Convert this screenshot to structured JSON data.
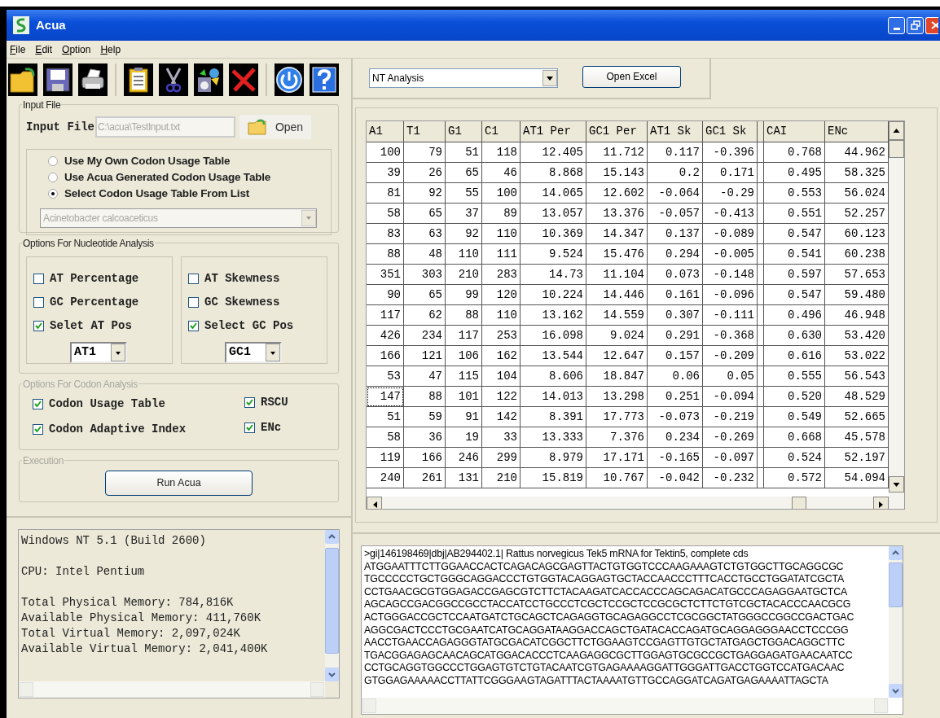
{
  "window": {
    "title": "Acua"
  },
  "menu": [
    "File",
    "Edit",
    "Option",
    "Help"
  ],
  "input_group": {
    "title": "Input File",
    "title_disabled": false,
    "label": "Input File",
    "value": "C:\\acua\\TestInput.txt",
    "disabled": true,
    "open_button": "Open",
    "options": [
      {
        "label": "Use My Own Codon Usage Table",
        "selected": false
      },
      {
        "label": "Use Acua Generated Codon Usage Table",
        "selected": false
      },
      {
        "label": "Select Codon Usage Table From List",
        "selected": true
      }
    ],
    "species_select": {
      "value": "Acinetobacter calcoaceticus",
      "disabled": true
    }
  },
  "nucleotide_group": {
    "title": "Options For Nucleotide Analysis",
    "title_disabled": false,
    "panels": [
      {
        "checks": [
          {
            "label": "AT Percentage",
            "checked": false
          },
          {
            "label": "GC Percentage",
            "checked": false
          },
          {
            "label": "Selet AT Pos",
            "checked": true
          }
        ],
        "select": "AT1"
      },
      {
        "checks": [
          {
            "label": "AT Skewness",
            "checked": false
          },
          {
            "label": "GC Skewness",
            "checked": false
          },
          {
            "label": "Select GC Pos",
            "checked": true
          }
        ],
        "select": "GC1"
      }
    ]
  },
  "codon_group": {
    "title": "Options For Codon Analysis",
    "title_disabled": true,
    "checks": [
      {
        "label": "Codon Usage Table",
        "checked": true
      },
      {
        "label": "RSCU",
        "checked": true
      },
      {
        "label": "Codon Adaptive Index",
        "checked": true
      },
      {
        "label": "ENc",
        "checked": true
      }
    ]
  },
  "execution_group": {
    "title": "Execution",
    "title_disabled": true,
    "button": "Run Acua"
  },
  "analysis_select": "NT Analysis",
  "open_excel_button": "Open Excel",
  "table": {
    "columns": [
      "A1",
      "T1",
      "G1",
      "C1",
      "AT1 Per",
      "GC1 Per",
      "AT1 Sk",
      "GC1 Sk",
      "CAI",
      "ENc"
    ],
    "rows": [
      {
        "cells": [
          "100",
          "79",
          "51",
          "118",
          "12.405",
          "11.712",
          "0.117",
          "-0.396",
          "0.768",
          "44.962"
        ],
        "selected": false
      },
      {
        "cells": [
          "39",
          "26",
          "65",
          "46",
          "8.868",
          "15.143",
          "0.2",
          "0.171",
          "0.495",
          "58.325"
        ],
        "selected": false
      },
      {
        "cells": [
          "81",
          "92",
          "55",
          "100",
          "14.065",
          "12.602",
          "-0.064",
          "-0.29",
          "0.553",
          "56.024"
        ],
        "selected": false
      },
      {
        "cells": [
          "58",
          "65",
          "37",
          "89",
          "13.057",
          "13.376",
          "-0.057",
          "-0.413",
          "0.551",
          "52.257"
        ],
        "selected": false
      },
      {
        "cells": [
          "83",
          "63",
          "92",
          "110",
          "10.369",
          "14.347",
          "0.137",
          "-0.089",
          "0.547",
          "60.123"
        ],
        "selected": false
      },
      {
        "cells": [
          "88",
          "48",
          "110",
          "111",
          "9.524",
          "15.476",
          "0.294",
          "-0.005",
          "0.541",
          "60.238"
        ],
        "selected": false
      },
      {
        "cells": [
          "351",
          "303",
          "210",
          "283",
          "14.73",
          "11.104",
          "0.073",
          "-0.148",
          "0.597",
          "57.653"
        ],
        "selected": false
      },
      {
        "cells": [
          "90",
          "65",
          "99",
          "120",
          "10.224",
          "14.446",
          "0.161",
          "-0.096",
          "0.547",
          "59.480"
        ],
        "selected": false
      },
      {
        "cells": [
          "117",
          "62",
          "88",
          "110",
          "13.162",
          "14.559",
          "0.307",
          "-0.111",
          "0.496",
          "46.948"
        ],
        "selected": false
      },
      {
        "cells": [
          "426",
          "234",
          "117",
          "253",
          "16.098",
          "9.024",
          "0.291",
          "-0.368",
          "0.630",
          "53.420"
        ],
        "selected": false
      },
      {
        "cells": [
          "166",
          "121",
          "106",
          "162",
          "13.544",
          "12.647",
          "0.157",
          "-0.209",
          "0.616",
          "53.022"
        ],
        "selected": false
      },
      {
        "cells": [
          "53",
          "47",
          "115",
          "104",
          "8.606",
          "18.847",
          "0.06",
          "0.05",
          "0.555",
          "56.543"
        ],
        "selected": false
      },
      {
        "cells": [
          "147",
          "88",
          "101",
          "122",
          "14.013",
          "13.298",
          "0.251",
          "-0.094",
          "0.520",
          "48.529"
        ],
        "selected": true
      },
      {
        "cells": [
          "51",
          "59",
          "91",
          "142",
          "8.391",
          "17.773",
          "-0.073",
          "-0.219",
          "0.549",
          "52.665"
        ],
        "selected": false
      },
      {
        "cells": [
          "58",
          "36",
          "19",
          "33",
          "13.333",
          "7.376",
          "0.234",
          "-0.269",
          "0.668",
          "45.578"
        ],
        "selected": false
      },
      {
        "cells": [
          "119",
          "166",
          "246",
          "299",
          "8.979",
          "17.171",
          "-0.165",
          "-0.097",
          "0.524",
          "52.197"
        ],
        "selected": false
      },
      {
        "cells": [
          "240",
          "261",
          "131",
          "210",
          "15.819",
          "10.767",
          "-0.042",
          "-0.232",
          "0.572",
          "54.094"
        ],
        "selected": false
      }
    ]
  },
  "system_info": [
    [
      "Windows NT 5.1 (Build 2600)"
    ],
    [
      "CPU: Intel Pentium"
    ],
    [
      "Total Physical Memory: 784,816K",
      "Available Physical Memory: 411,760K",
      "Total Virtual Memory: 2,097,024K",
      "Available Virtual Memory: 2,041,400K"
    ]
  ],
  "sequence": {
    "header": ">gi|146198469|dbj|AB294402.1| Rattus norvegicus Tek5 mRNA for Tektin5, complete cds",
    "lines": [
      "ATGGAATTTCTTGGAACCACTCAGACAGCGAGTTACTGTGGTCCCAAGAAAGTCTGTGGCTTGCAGGCGC",
      "TGCCCCCTGCTGGGCAGGACCCTGTGGTACAGGAGTGCTACCAACCCTTTCACCTGCCTGGATATCGCTA",
      "CCTGAACGCGTGGAGACCGAGCGTCTTCTACAAGATCACCACCCAGCAGACATGCCCAGAGGAATGCTCA",
      "AGCAGCCGACGGCCGCCTACCATCCTGCCCTCGCTCCGCTCCGCGCTCTTCTGTCGCTACACCCAACGCG",
      "ACTGGGACCGCTCCAATGATCTGCAGCTCAGAGGTGCAGAGGCCTCGCGGCTATGGGCCGGCCGACTGAC",
      "AGGCGACTCCCTGCGAATCATGCAGGATAAGGACCAGCTGATACACCAGATGCAGGAGGGAACCTCCCGG",
      "AACCTGAACCAGAGGGTATGCGACATCGGCTTCTGGAAGTCCGAGTTGTGCTATGAGCTGGACAGGCTTC",
      "TGACGGAGAGCAACAGCATGGACACCCTCAAGAGGCGCTTGGAGTGCGCCGCTGAGGAGATGAACAATCC",
      "CCTGCAGGTGGCCCTGGAGTGTCTGTACAATCGTGAGAAAAGGATTGGGATTGACCTGGTCCATGACAAC",
      "GTGGAGAAAAACCTTATTCGGGAAGTAGATTTACTAAAATGTTGCCAGGATCAGATGAGAAAATTAGCTA"
    ]
  }
}
